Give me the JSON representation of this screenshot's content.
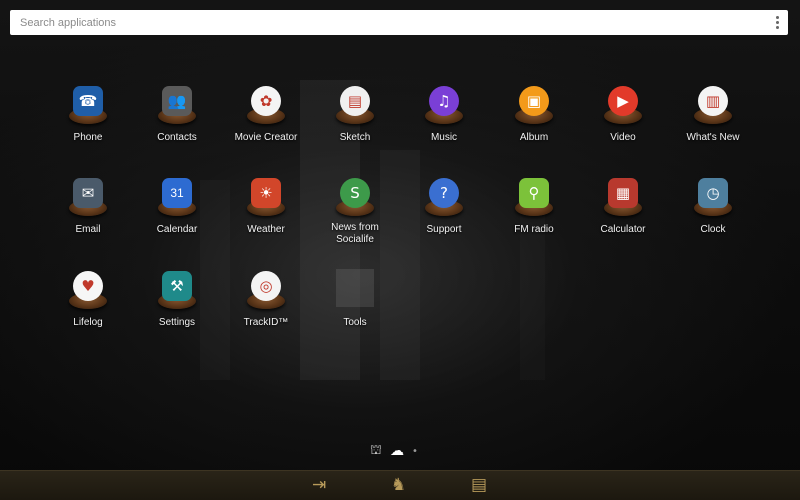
{
  "search": {
    "placeholder": "Search applications"
  },
  "apps": [
    {
      "label": "Phone",
      "icon": "phone-icon",
      "glyph": "☎",
      "color": "#1f5ea8",
      "round": false
    },
    {
      "label": "Contacts",
      "icon": "contacts-icon",
      "glyph": "👥",
      "color": "#5a5a5a",
      "round": false
    },
    {
      "label": "Movie Creator",
      "icon": "movie-creator-icon",
      "glyph": "✿",
      "color": "#f4f4f4",
      "round": true
    },
    {
      "label": "Sketch",
      "icon": "sketch-icon",
      "glyph": "▤",
      "color": "#f0f0f0",
      "round": true
    },
    {
      "label": "Music",
      "icon": "music-icon",
      "glyph": "♫",
      "color": "#7a3fd6",
      "round": true
    },
    {
      "label": "Album",
      "icon": "album-icon",
      "glyph": "▣",
      "color": "#f39a1a",
      "round": true
    },
    {
      "label": "Video",
      "icon": "video-icon",
      "glyph": "▶",
      "color": "#e23a2a",
      "round": true
    },
    {
      "label": "What's New",
      "icon": "whats-new-icon",
      "glyph": "▥",
      "color": "#f4f4f4",
      "round": true
    },
    {
      "label": "Email",
      "icon": "email-icon",
      "glyph": "✉",
      "color": "#4a5a6a",
      "round": false
    },
    {
      "label": "Calendar",
      "icon": "calendar-icon",
      "glyph": "31",
      "color": "#2d6bd1",
      "round": false
    },
    {
      "label": "Weather",
      "icon": "weather-icon",
      "glyph": "☀",
      "color": "#d2462a",
      "round": false
    },
    {
      "label": "News from Socialife",
      "icon": "news-icon",
      "glyph": "S",
      "color": "#3d9a4a",
      "round": true
    },
    {
      "label": "Support",
      "icon": "support-icon",
      "glyph": "?",
      "color": "#3a6fd1",
      "round": true
    },
    {
      "label": "FM radio",
      "icon": "fm-radio-icon",
      "glyph": "⚲",
      "color": "#7cc23a",
      "round": false
    },
    {
      "label": "Calculator",
      "icon": "calculator-icon",
      "glyph": "▦",
      "color": "#b8392e",
      "round": false
    },
    {
      "label": "Clock",
      "icon": "clock-icon",
      "glyph": "◷",
      "color": "#4e7f9e",
      "round": false
    },
    {
      "label": "Lifelog",
      "icon": "lifelog-icon",
      "glyph": "♥",
      "color": "#f6f6f6",
      "round": true
    },
    {
      "label": "Settings",
      "icon": "settings-icon",
      "glyph": "⚒",
      "color": "#1f8a8a",
      "round": false
    },
    {
      "label": "TrackID™",
      "icon": "trackid-icon",
      "glyph": "◎",
      "color": "#f4f4f4",
      "round": true
    },
    {
      "label": "Tools",
      "icon": "tools-folder-icon",
      "glyph": "",
      "color": "transparent",
      "round": false
    }
  ],
  "pager": {
    "items": [
      {
        "icon": "binoculars-icon",
        "glyph": "⛫"
      },
      {
        "icon": "ghost-icon",
        "glyph": "☁"
      },
      {
        "icon": "page-dot-icon",
        "glyph": "•"
      }
    ]
  },
  "dock": {
    "items": [
      {
        "icon": "exit-door-icon",
        "glyph": "⇥"
      },
      {
        "icon": "figure-icon",
        "glyph": "♞"
      },
      {
        "icon": "book-icon",
        "glyph": "▤"
      }
    ]
  }
}
